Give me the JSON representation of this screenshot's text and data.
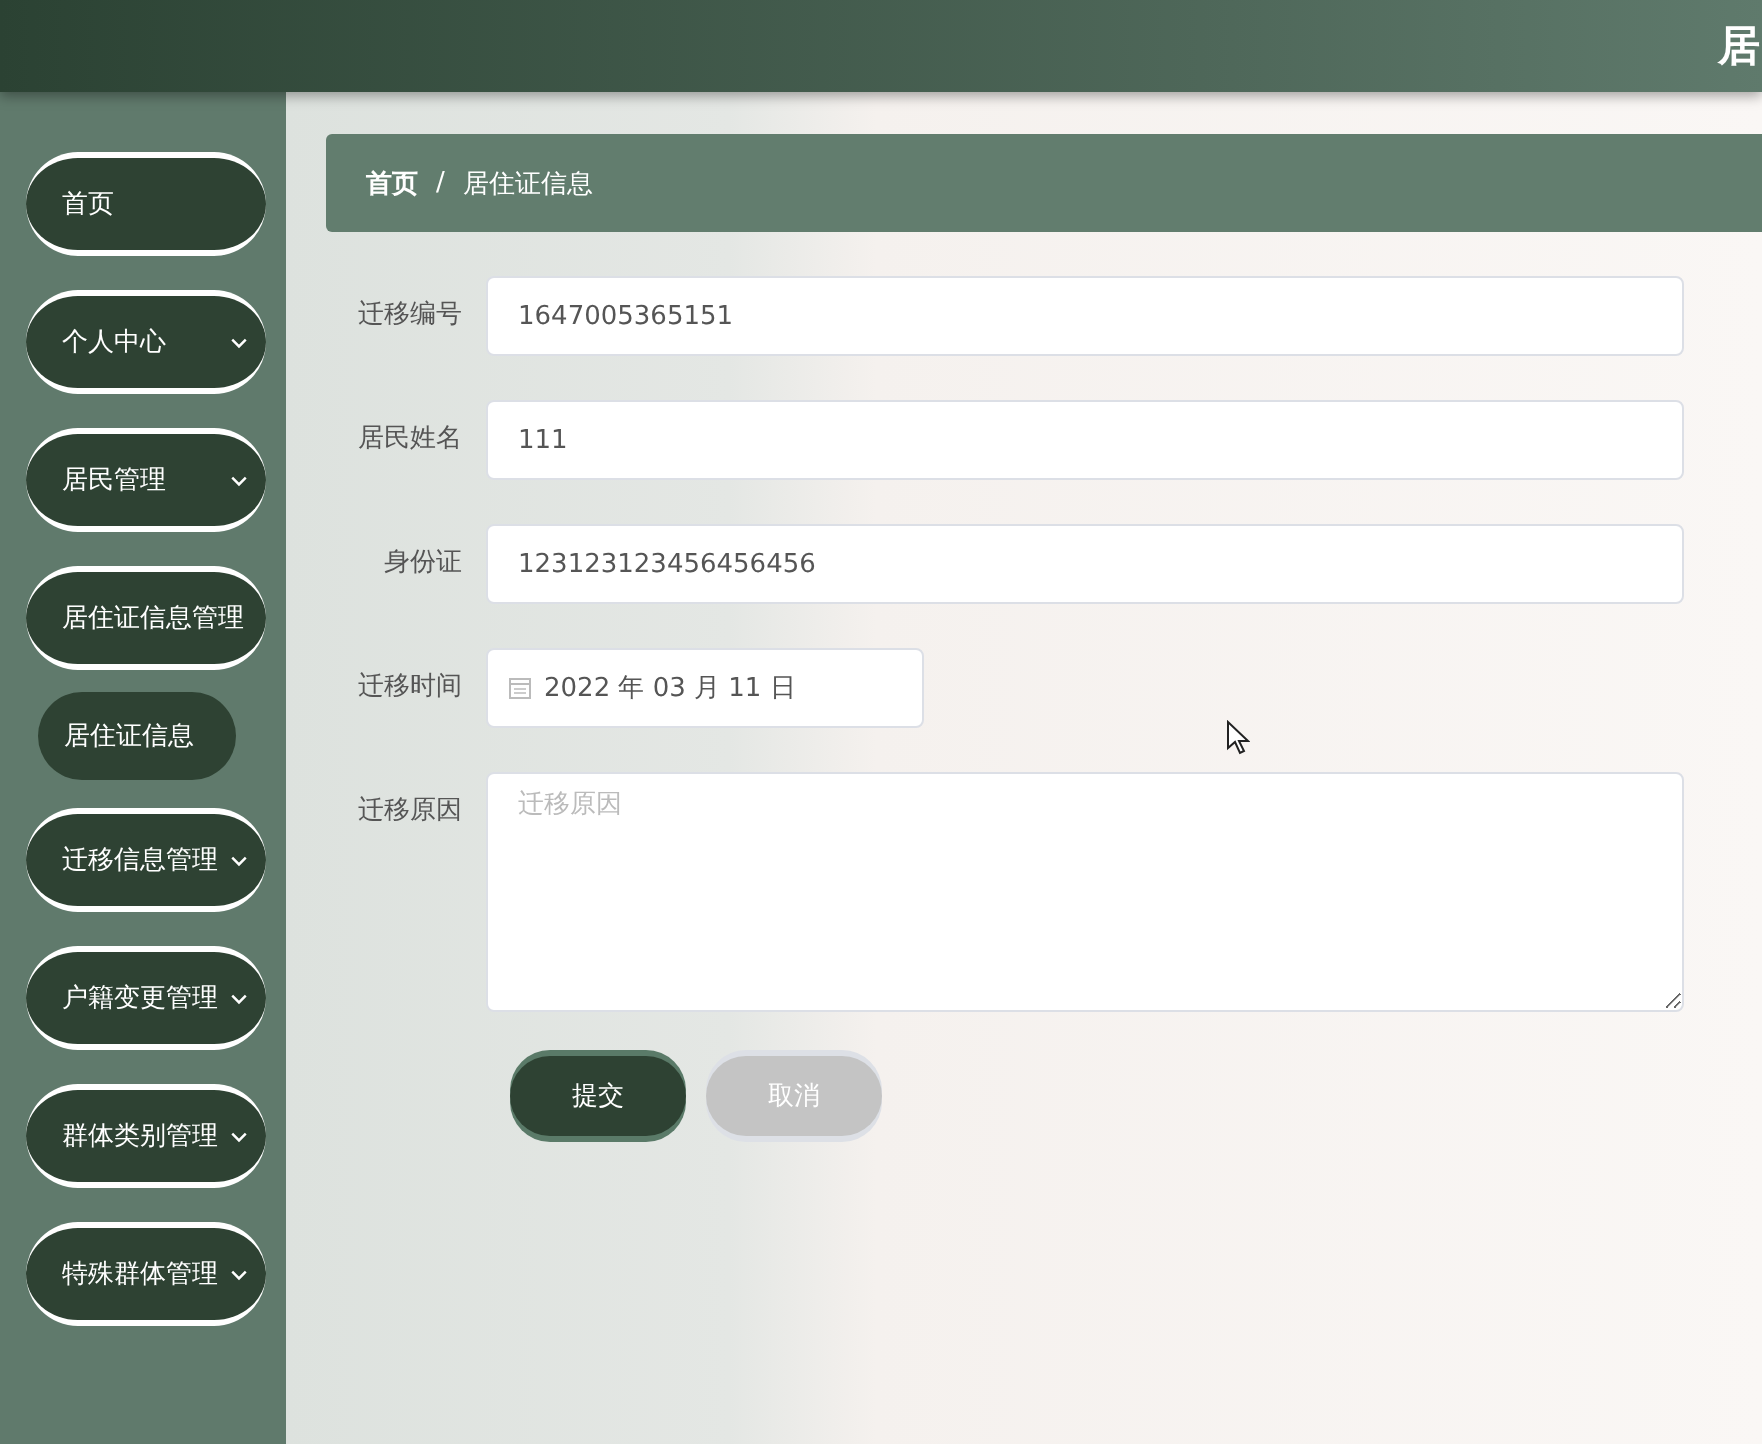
{
  "header": {
    "title": "居"
  },
  "sidebar": {
    "items": [
      {
        "kind": "menu",
        "label": "首页",
        "collapsible": false
      },
      {
        "kind": "menu",
        "label": "个人中心",
        "collapsible": true
      },
      {
        "kind": "menu",
        "label": "居民管理",
        "collapsible": true
      },
      {
        "kind": "menu",
        "label": "居住证信息管理",
        "collapsible": false
      },
      {
        "kind": "submenu",
        "label": "居住证信息"
      },
      {
        "kind": "menu",
        "label": "迁移信息管理",
        "collapsible": true
      },
      {
        "kind": "menu",
        "label": "户籍变更管理",
        "collapsible": true
      },
      {
        "kind": "menu",
        "label": "群体类别管理",
        "collapsible": true
      },
      {
        "kind": "menu",
        "label": "特殊群体管理",
        "collapsible": true
      }
    ]
  },
  "breadcrumb": [
    "首页",
    "/",
    "居住证信息"
  ],
  "form": {
    "fields": [
      {
        "kind": "text",
        "label": "迁移编号",
        "value": "1647005365151"
      },
      {
        "kind": "text",
        "label": "居民姓名",
        "value": "111"
      },
      {
        "kind": "text",
        "label": "身份证",
        "value": "123123123456456456"
      },
      {
        "kind": "date",
        "label": "迁移时间",
        "value": "2022 年 03 月 11 日"
      },
      {
        "kind": "textarea",
        "label": "迁移原因",
        "placeholder": "迁移原因"
      }
    ],
    "buttons": [
      {
        "kind": "primary",
        "label": "提交"
      },
      {
        "kind": "secondary",
        "label": "取消"
      }
    ]
  }
}
